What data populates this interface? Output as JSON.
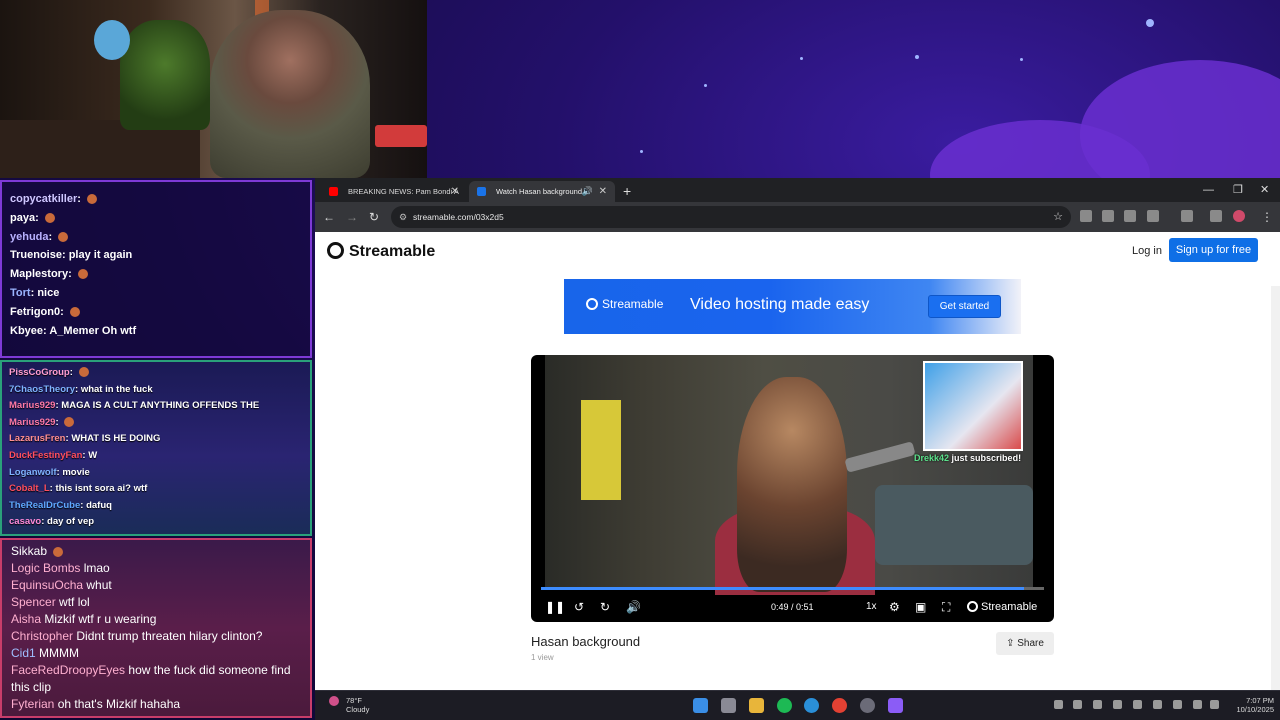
{
  "chat_top": [
    {
      "user": "copycatkiller",
      "color": "#cfc7ff",
      "msg": ""
    },
    {
      "user": "paya",
      "color": "#ffffff",
      "msg": ""
    },
    {
      "user": "yehuda",
      "color": "#b9b2ff",
      "msg": ""
    },
    {
      "user": "Truenoise",
      "color": "#ffffff",
      "msg": "play it again"
    },
    {
      "user": "Maplestory",
      "color": "#ffffff",
      "msg": ""
    },
    {
      "user": "Tort",
      "color": "#9bb4ff",
      "msg": "nice"
    },
    {
      "user": "Fetrigon0",
      "color": "#ffffff",
      "msg": ""
    },
    {
      "user": "Kbyee",
      "color": "#ffffff",
      "msg": "A_Memer Oh wtf"
    }
  ],
  "chat_mid": [
    {
      "user": "PissCoGroup",
      "color": "#ff9dd0",
      "msg": ""
    },
    {
      "user": "7ChaosTheory",
      "color": "#7fb3ff",
      "msg": "what in the fuck"
    },
    {
      "user": "Marius929",
      "color": "#ff7aa8",
      "msg": "MAGA IS A CULT ANYTHING OFFENDS THE"
    },
    {
      "user": "Marius929",
      "color": "#ff7aa8",
      "msg": ""
    },
    {
      "user": "LazarusFren",
      "color": "#ff8f8f",
      "msg": "WHAT IS HE DOING"
    },
    {
      "user": "DuckFestinyFan",
      "color": "#ff4f5f",
      "msg": "W"
    },
    {
      "user": "Loganwolf",
      "color": "#7fb3ff",
      "msg": "movie"
    },
    {
      "user": "Cobalt_L",
      "color": "#ff4f5f",
      "msg": "this isnt sora ai? wtf"
    },
    {
      "user": "TheRealDrCube",
      "color": "#5fa8ff",
      "msg": "dafuq"
    },
    {
      "user": "casavo",
      "color": "#ff8ad8",
      "msg": "day of vep"
    }
  ],
  "chat_bottom": [
    {
      "user": "Sikkab",
      "color": "#ffffff",
      "msg": ""
    },
    {
      "user": "Logic Bombs",
      "color": "#ffb0d0",
      "msg": "lmao"
    },
    {
      "user": "EquinsuOcha",
      "color": "#ffb0d0",
      "msg": "whut"
    },
    {
      "user": "Spencer",
      "color": "#ffb0d0",
      "msg": "wtf lol"
    },
    {
      "user": "Aisha",
      "color": "#ffb0d0",
      "msg": "Mizkif wtf r u wearing"
    },
    {
      "user": "Christopher",
      "color": "#ffb0d0",
      "msg": "Didnt trump threaten hilary clinton?"
    },
    {
      "user": "Cid1",
      "color": "#9fbfff",
      "msg": "MMMM"
    },
    {
      "user": "FaceRedDroopyEyes",
      "color": "#ffb0d0",
      "msg": "how the fuck did someone find this clip"
    },
    {
      "user": "Fyterian",
      "color": "#ffb0d0",
      "msg": "oh that's Mizkif hahaha"
    }
  ],
  "browser": {
    "tabs": [
      {
        "title": "BREAKING NEWS: Pam Bondi A",
        "favicon_color": "#ff0000"
      },
      {
        "title": "Watch Hasan background |",
        "favicon_color": "#1a73e8"
      }
    ],
    "url": "streamable.com/03x2d5"
  },
  "streamable": {
    "brand": "Streamable",
    "login": "Log in",
    "signup": "Sign up for free",
    "banner_brand": "Streamable",
    "banner_tagline": "Video hosting made easy",
    "banner_cta": "Get started",
    "accent": "#0f6fe6"
  },
  "player": {
    "time": "0:49 / 0:51",
    "progress": 0.96,
    "speed": "1x",
    "watermark": "Streamable",
    "sub_name": "Drekk42",
    "sub_text": "just subscribed!"
  },
  "video": {
    "title": "Hasan background",
    "views": "1 view",
    "share": "Share"
  },
  "taskbar": {
    "temp": "78°F",
    "condition": "Cloudy",
    "time": "7:07 PM",
    "date": "10/10/2025"
  }
}
